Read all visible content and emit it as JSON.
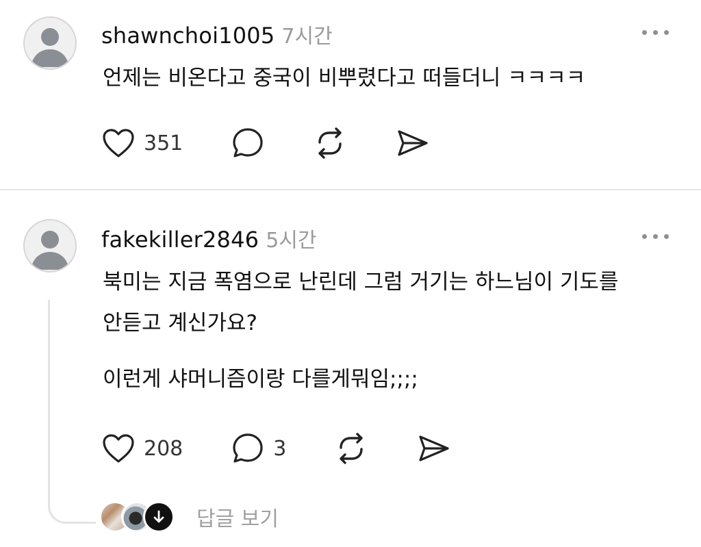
{
  "posts": [
    {
      "username": "shawnchoi1005",
      "time": "7시간",
      "lines": [
        "언제는 비온다고 중국이 비뿌렸다고 떠들더니 ㅋㅋㅋㅋ"
      ],
      "likes": "351",
      "replies": "",
      "icons": [
        "heart-icon",
        "comment-icon",
        "repost-icon",
        "share-icon",
        "more-icon"
      ]
    },
    {
      "username": "fakekiller2846",
      "time": "5시간",
      "lines": [
        "북미는 지금 폭염으로 난린데 그럼 거기는 하느님이 기도를",
        "안듣고 계신가요?",
        "이런게 샤머니즘이랑 다를게뭐임;;;;"
      ],
      "likes": "208",
      "replies": "3",
      "view_replies": "답글 보기",
      "icons": [
        "heart-icon",
        "comment-icon",
        "repost-icon",
        "share-icon",
        "more-icon"
      ]
    }
  ],
  "colors": {
    "text": "#111111",
    "muted": "#9a9a9a",
    "divider": "#e6e6e6",
    "icon": "#222222"
  }
}
